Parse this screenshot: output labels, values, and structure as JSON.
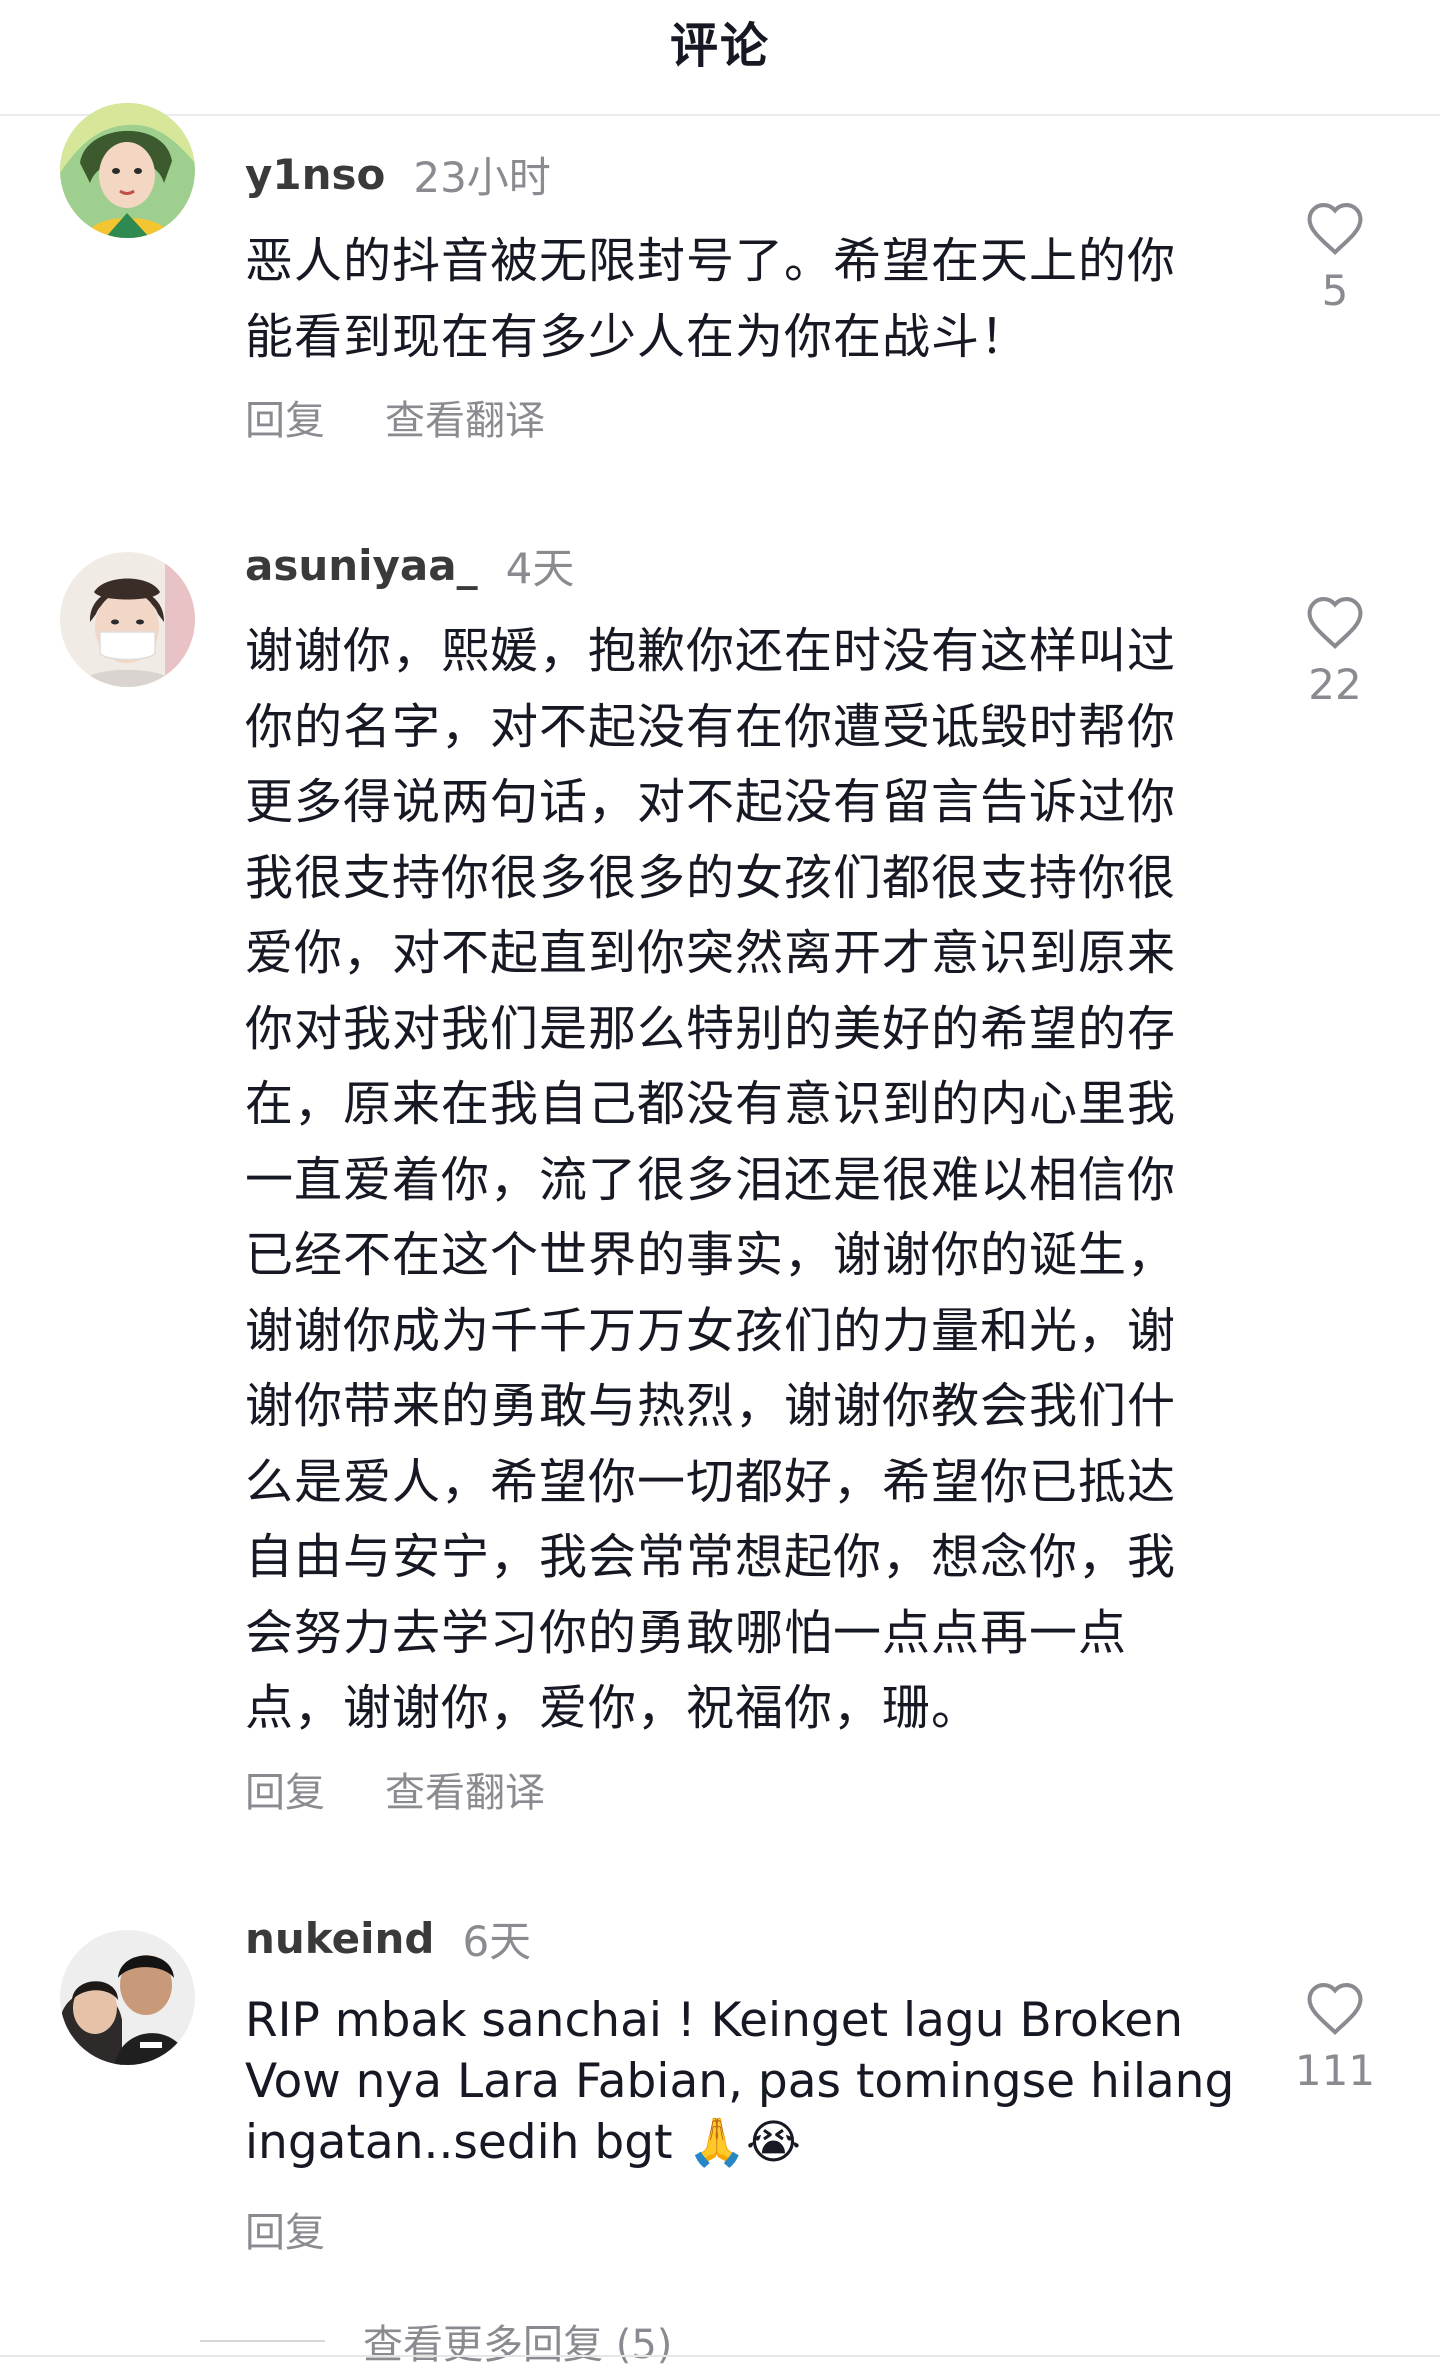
{
  "header": {
    "title": "评论"
  },
  "comments": [
    {
      "username": "y1nso",
      "time": "23小时",
      "text": "恶人的抖音被无限封号了。希望在天上的你\n能看到现在有多少人在为你在战斗！",
      "likes": "5",
      "reply_label": "回复",
      "translate_label": "查看翻译",
      "avatar_icon": "avatar-woman-green-icon"
    },
    {
      "username": "asuniyaa_",
      "time": "4天",
      "text": "谢谢你，熙媛，抱歉你还在时没有这样叫过\n你的名字，对不起没有在你遭受诋毁时帮你\n更多得说两句话，对不起没有留言告诉过你\n我很支持你很多很多的女孩们都很支持你很\n爱你，对不起直到你突然离开才意识到原来\n你对我对我们是那么特别的美好的希望的存\n在，原来在我自己都没有意识到的内心里我\n一直爱着你，流了很多泪还是很难以相信你\n已经不在这个世界的事实，谢谢你的诞生，\n谢谢你成为千千万万女孩们的力量和光，谢\n谢你带来的勇敢与热烈，谢谢你教会我们什\n么是爱人，希望你一切都好，希望你已抵达\n自由与安宁，我会常常想起你，想念你，我\n会努力去学习你的勇敢哪怕一点点再一点\n点，谢谢你，爱你，祝福你，珊。",
      "likes": "22",
      "reply_label": "回复",
      "translate_label": "查看翻译",
      "avatar_icon": "avatar-masked-person-icon"
    },
    {
      "username": "nukeind",
      "time": "6天",
      "text": "RIP mbak sanchai ! Keinget lagu Broken Vow nya Lara Fabian, pas tomingse hilang ingatan..sedih bgt 🙏😭",
      "likes": "111",
      "reply_label": "回复",
      "avatar_icon": "avatar-couple-icon"
    }
  ],
  "more_replies": "查看更多回复 (5)",
  "colors": {
    "text": "#161823",
    "secondary": "#8a8b91",
    "divider": "#ececec"
  },
  "icons": {
    "like": "heart-outline-icon"
  }
}
